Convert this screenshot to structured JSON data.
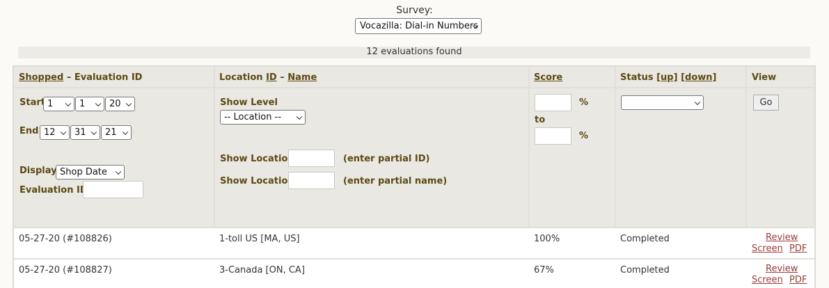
{
  "survey": {
    "label": "Survey:",
    "selected": "Vocazilla: Dial-in Numbers"
  },
  "results": {
    "found_text": "12 evaluations found"
  },
  "header": {
    "col1_link": "Shopped",
    "col1_rest": " – Evaluation ID",
    "col2_label": "Location ",
    "col2_id_link": "ID",
    "col2_sep": " – ",
    "col2_name_link": "Name",
    "col3_link": "Score",
    "col4_label": "Status ",
    "col4_up": "[up]",
    "col4_down": "[down]",
    "col5_label": "View"
  },
  "filters": {
    "start_label": "Start",
    "start_month": "1",
    "start_day": "1",
    "start_year": "20",
    "end_label": "End",
    "end_month": "12",
    "end_day": "31",
    "end_year": "21",
    "display_label": "Display",
    "display_value": "Shop Date",
    "evalid_label": "Evaluation ID",
    "show_level_label": "Show Level",
    "show_level_value": "-- Location --",
    "show_location_label": "Show Location",
    "partial_id_hint": "(enter partial ID)",
    "partial_name_hint": "(enter partial name)",
    "pct": "%",
    "to_label": "to",
    "status_value": "",
    "go_label": "Go"
  },
  "rows": [
    {
      "shopped": "05-27-20 (#108826)",
      "location": "1-toll US [MA, US]",
      "score": "100%",
      "status": "Completed",
      "review": "Review",
      "screen": "Screen",
      "pdf": "PDF"
    },
    {
      "shopped": "05-27-20 (#108827)",
      "location": "3-Canada [ON, CA]",
      "score": "67%",
      "status": "Completed",
      "review": "Review",
      "screen": "Screen",
      "pdf": "PDF"
    }
  ]
}
